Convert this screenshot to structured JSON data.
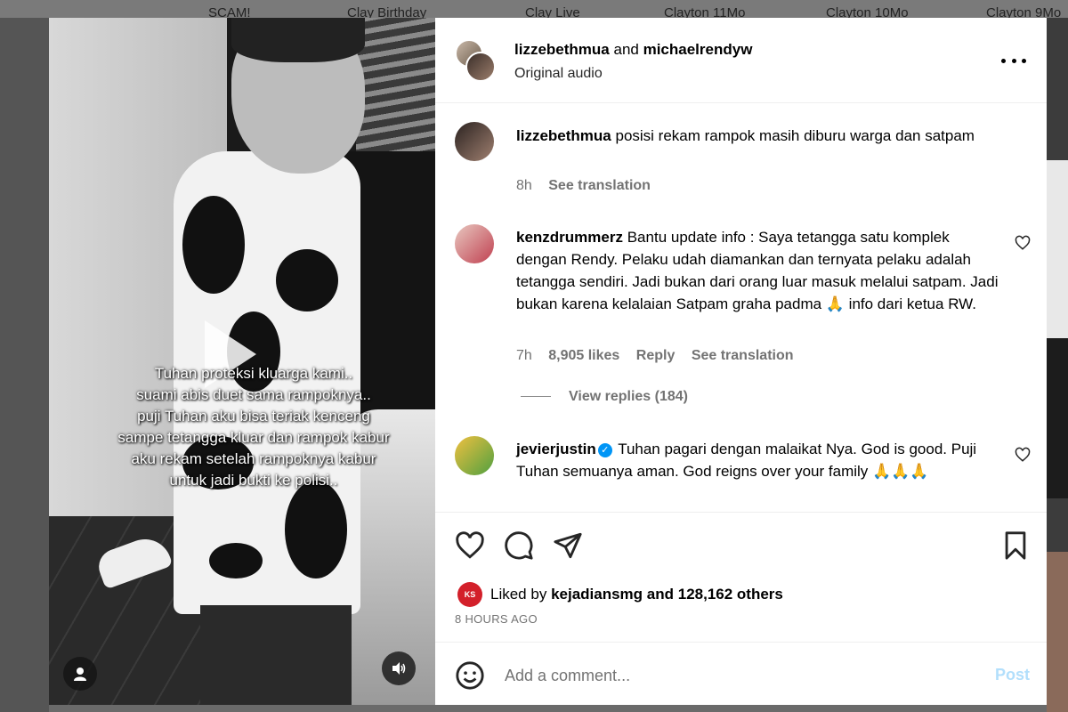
{
  "background": {
    "tabs": [
      "SCAM!",
      "Clay Birthday",
      "Clay Live",
      "Clayton 11Mo",
      "Clayton 10Mo",
      "Clayton 9Mo"
    ]
  },
  "video": {
    "caption": "Tuhan proteksi kluarga kami..\nsuami abis duet sama rampoknya..\npuji Tuhan aku bisa teriak kenceng\nsampe tetangga kluar dan rampok kabur\naku rekam setelah rampoknya kabur\nuntuk jadi bukti ke polisi.."
  },
  "header": {
    "user1": "lizzebethmua",
    "connector": "and",
    "user2": "michaelrendyw",
    "audio": "Original audio"
  },
  "comments": [
    {
      "user": "lizzebethmua",
      "text": "posisi rekam rampok masih diburu warga dan satpam",
      "time": "8h",
      "see_translation": "See translation"
    },
    {
      "user": "kenzdrummerz",
      "text": "Bantu update info : Saya tetangga satu komplek dengan Rendy. Pelaku udah diamankan dan ternyata pelaku adalah tetangga sendiri. Jadi bukan dari orang luar masuk melalui satpam. Jadi bukan karena kelalaian Satpam graha padma 🙏 info dari ketua RW.",
      "time": "7h",
      "likes": "8,905 likes",
      "reply": "Reply",
      "see_translation": "See translation",
      "view_replies": "View replies (184)"
    },
    {
      "user": "jevierjustin",
      "text": "Tuhan pagari dengan malaikat Nya. God is good. Puji Tuhan semuanya aman. God reigns over your family 🙏🙏🙏"
    }
  ],
  "likes": {
    "prefix": "Liked by",
    "user": "kejadiansmg",
    "suffix": "and 128,162 others",
    "badge": "KS",
    "time": "8 HOURS AGO"
  },
  "add_comment": {
    "placeholder": "Add a comment...",
    "post": "Post"
  }
}
